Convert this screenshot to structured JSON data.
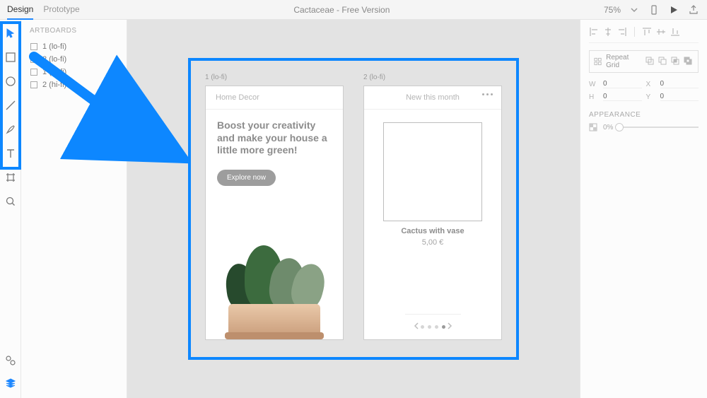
{
  "toolbar": {
    "tabs": {
      "design": "Design",
      "prototype": "Prototype"
    },
    "title": "Cactaceae - Free Version",
    "zoom": "75%"
  },
  "left_tools": [
    {
      "name": "select",
      "active": true
    },
    {
      "name": "rectangle"
    },
    {
      "name": "ellipse"
    },
    {
      "name": "line"
    },
    {
      "name": "pen"
    },
    {
      "name": "text"
    },
    {
      "name": "artboard"
    },
    {
      "name": "zoom"
    }
  ],
  "panels": {
    "artboards_title": "ARTBOARDS",
    "artboards": [
      "1 (lo-fi)",
      "2 (lo-fi)",
      "1 (hi-fi)",
      "2 (hi-fi)"
    ]
  },
  "canvas": {
    "artboard1": {
      "label": "1 (lo-fi)",
      "header": "Home Decor",
      "headline": "Boost your creativity and make your house a little more green!",
      "cta": "Explore now"
    },
    "artboard2": {
      "label": "2 (lo-fi)",
      "header": "New this month",
      "product_name": "Cactus with vase",
      "price": "5,00 €"
    }
  },
  "right": {
    "repeat_label": "Repeat Grid",
    "size": {
      "w_label": "W",
      "w": "0",
      "x_label": "X",
      "x": "0",
      "h_label": "H",
      "h": "0",
      "y_label": "Y",
      "y": "0"
    },
    "appearance_title": "APPEARANCE",
    "opacity": "0%"
  }
}
